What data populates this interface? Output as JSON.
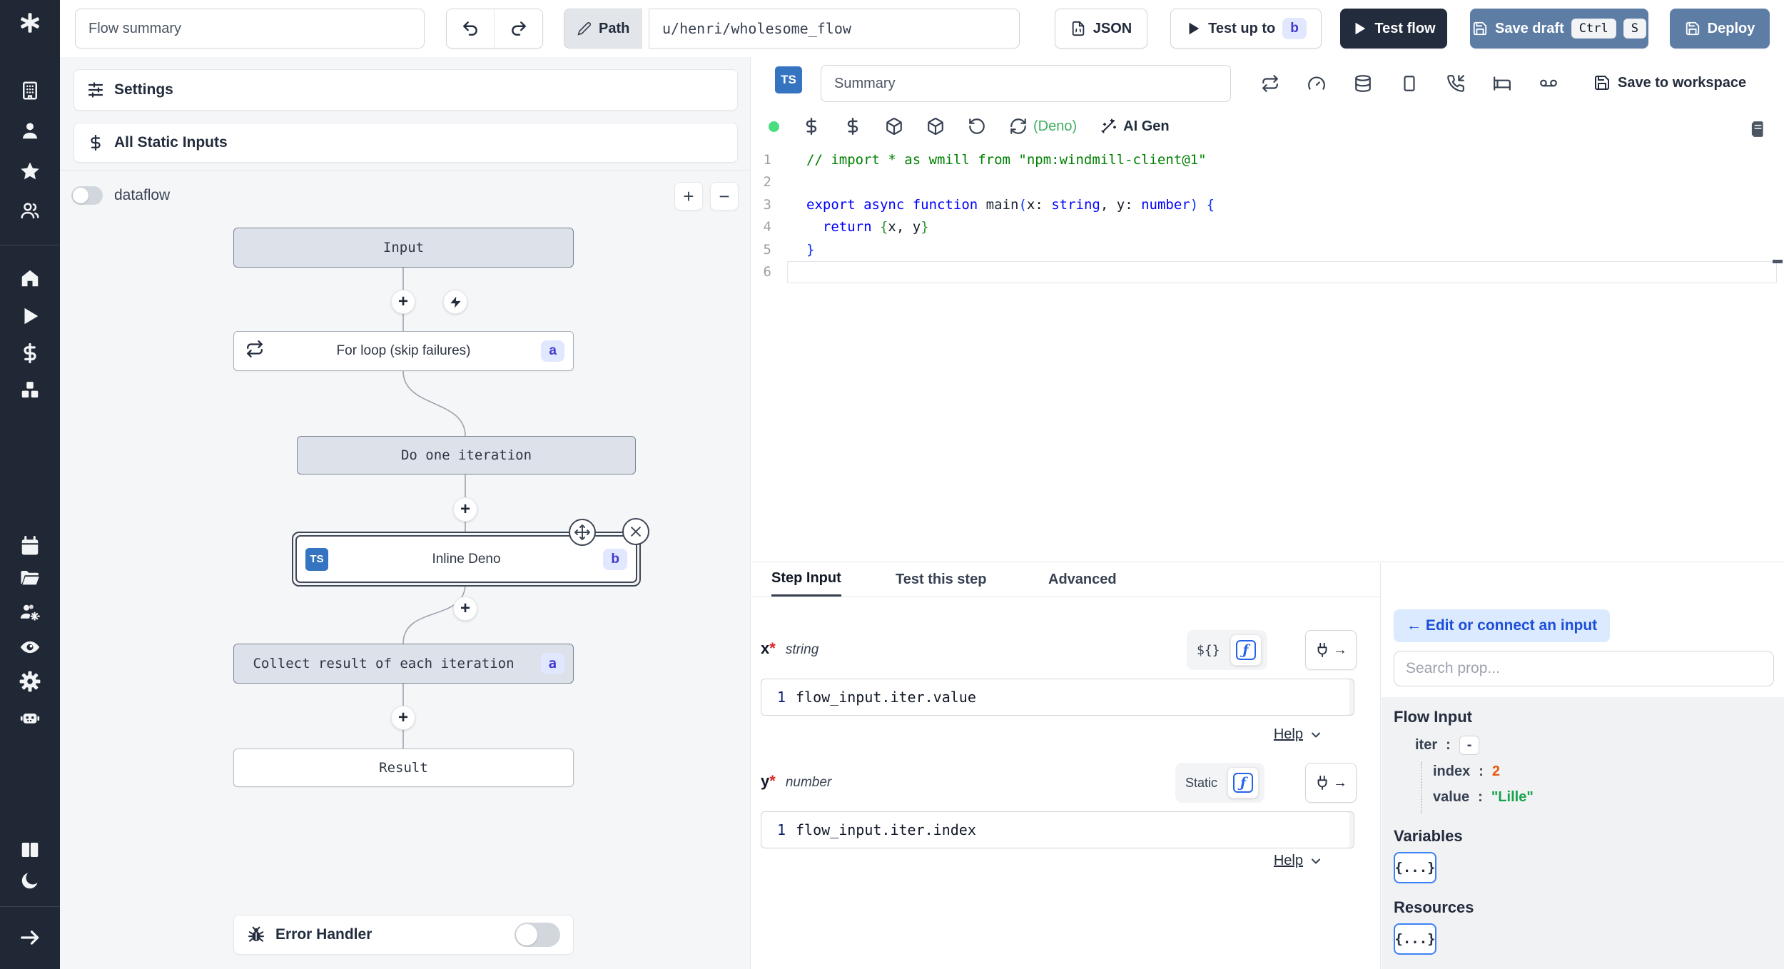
{
  "topbar": {
    "flow_summary_placeholder": "Flow summary",
    "path_label": "Path",
    "path_value": "u/henri/wholesome_flow",
    "json_label": "JSON",
    "test_up_to_label": "Test up to",
    "test_up_to_badge": "b",
    "test_flow_label": "Test flow",
    "save_draft_label": "Save draft",
    "kbd_ctrl": "Ctrl",
    "kbd_s": "S",
    "deploy_label": "Deploy"
  },
  "sidebar": {
    "icons_top": [
      "windmill-logo",
      "building",
      "user",
      "star",
      "users"
    ],
    "icons_main": [
      "home",
      "play",
      "dollar",
      "boxes"
    ],
    "icons_secondary": [
      "calendar",
      "folder",
      "users-cog",
      "eye",
      "settings-gear",
      "bot"
    ],
    "icons_bottom": [
      "books",
      "moon",
      "arrow-right"
    ]
  },
  "flow_panel": {
    "settings_label": "Settings",
    "static_inputs_label": "All Static Inputs",
    "dataflow_label": "dataflow",
    "zoom_in": "+",
    "zoom_out": "−",
    "error_handler_label": "Error Handler",
    "nodes": {
      "input": {
        "label": "Input"
      },
      "forloop": {
        "label": "For loop (skip failures)",
        "badge": "a"
      },
      "iteration": {
        "label": "Do one iteration"
      },
      "inline_deno": {
        "label": "Inline Deno",
        "badge": "b",
        "lang": "TS"
      },
      "collect": {
        "label": "Collect result of each iteration",
        "badge": "a"
      },
      "result": {
        "label": "Result"
      }
    }
  },
  "editor": {
    "lang_badge": "TS",
    "summary_placeholder": "Summary",
    "runtime_label": "(Deno)",
    "ai_gen_label": "AI Gen",
    "save_to_workspace_label": "Save to workspace",
    "status_color": "#4ade80",
    "code_lines": [
      [
        [
          "cmt",
          "// import * as wmill from \"npm:windmill-client@1\""
        ]
      ],
      [],
      [
        [
          "kw",
          "export async function "
        ],
        [
          "fn",
          "main"
        ],
        [
          "br1",
          "("
        ],
        [
          "pl",
          "x"
        ],
        [
          "pl",
          ": "
        ],
        [
          "ty",
          "string"
        ],
        [
          "pl",
          ", "
        ],
        [
          "pl",
          "y"
        ],
        [
          "pl",
          ": "
        ],
        [
          "ty",
          "number"
        ],
        [
          "br1",
          ")"
        ],
        [
          "pl",
          " "
        ],
        [
          "br1",
          "{"
        ]
      ],
      [
        [
          "pl",
          "  "
        ],
        [
          "kw",
          "return "
        ],
        [
          "br2",
          "{"
        ],
        [
          "pl",
          "x, y"
        ],
        [
          "br2",
          "}"
        ]
      ],
      [
        [
          "br1",
          "}"
        ]
      ],
      []
    ]
  },
  "step_panel": {
    "tabs": [
      "Step Input",
      "Test this step",
      "Advanced"
    ],
    "active_tab": "Step Input",
    "fields": [
      {
        "name": "x",
        "required": "*",
        "type": "string",
        "mode": "${}",
        "line": "1",
        "value": "flow_input.iter.value",
        "help": "Help"
      },
      {
        "name": "y",
        "required": "*",
        "type": "number",
        "mode": "Static",
        "line": "1",
        "value": "flow_input.iter.index",
        "help": "Help"
      }
    ]
  },
  "prop_panel": {
    "edit_connect_label": "← Edit or connect an input",
    "search_placeholder": "Search prop...",
    "flow_input_title": "Flow Input",
    "tree": {
      "iter_key": "iter",
      "iter_sep": ":",
      "iter_value": "-",
      "index_key": "index",
      "index_sep": ":",
      "index_value": "2",
      "value_key": "value",
      "value_sep": ":",
      "value_value": "\"Lille\""
    },
    "variables_title": "Variables",
    "resources_title": "Resources",
    "object_button": "{...}"
  },
  "colors": {
    "sidebar_bg": "#202735",
    "steel_blue": "#5d7da5",
    "dark_navy": "#232c3d",
    "badge_bg": "#e0e7ff",
    "badge_text": "#4338ca",
    "index_orange": "#ea580c",
    "value_green": "#16a34a",
    "deno_green": "#3fae62",
    "status_green": "#4ade80"
  }
}
